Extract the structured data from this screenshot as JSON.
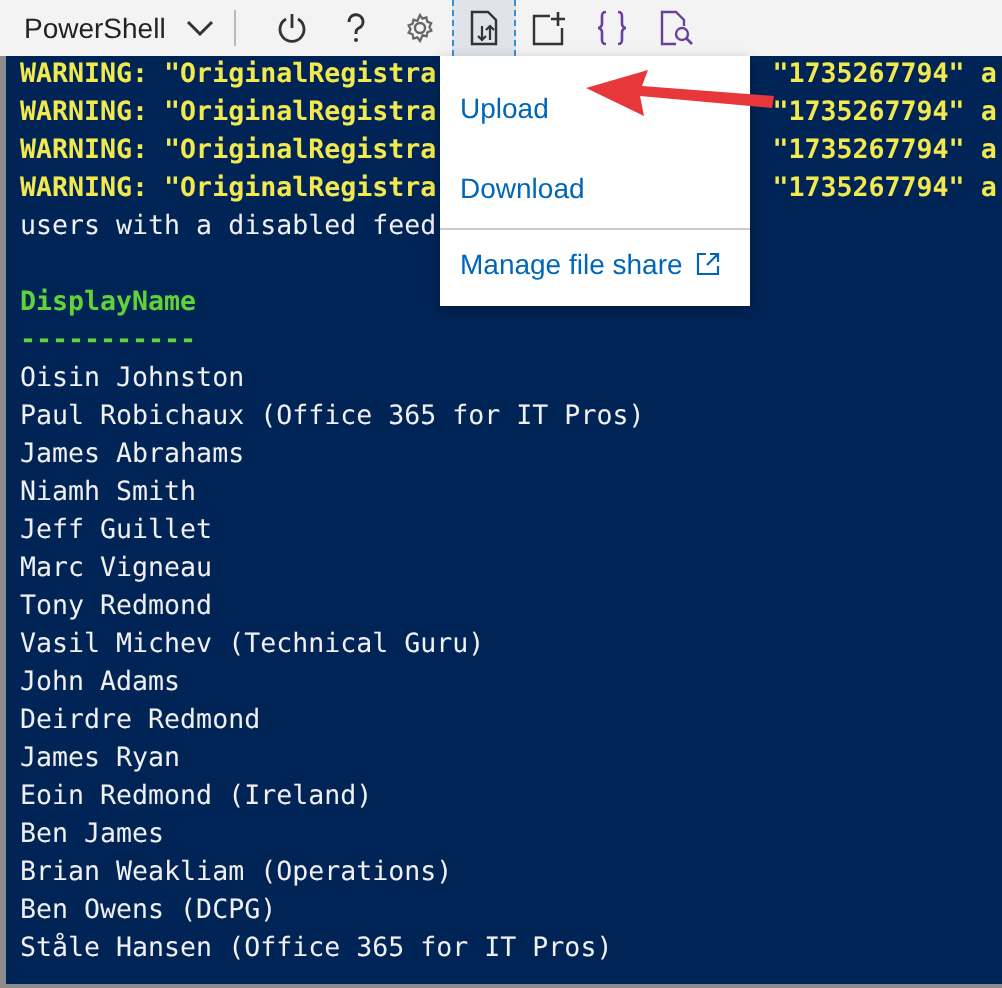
{
  "toolbar": {
    "shell_selector": "PowerShell",
    "buttons": [
      {
        "kind": "power",
        "selected": false
      },
      {
        "kind": "help",
        "selected": false
      },
      {
        "kind": "settings",
        "selected": false
      },
      {
        "kind": "upload-download",
        "selected": true
      },
      {
        "kind": "new-session",
        "selected": false
      },
      {
        "kind": "editor",
        "selected": false
      },
      {
        "kind": "web-preview",
        "selected": false
      }
    ]
  },
  "menu": {
    "items": [
      {
        "label": "Upload",
        "kind": "item"
      },
      {
        "label": "Download",
        "kind": "item"
      },
      {
        "label": "Manage file share",
        "kind": "external"
      }
    ]
  },
  "terminal": {
    "lines": [
      {
        "kind": "warning",
        "left": "WARNING: \"OriginalRegistra",
        "right": "\"1735267794\" a"
      },
      {
        "kind": "warning",
        "left": "WARNING: \"OriginalRegistra",
        "right": "\"1735267794\" a"
      },
      {
        "kind": "warning",
        "left": "WARNING: \"OriginalRegistra",
        "right": "\"1735267794\" a"
      },
      {
        "kind": "warning",
        "left": "WARNING: \"OriginalRegistra",
        "right": "\"1735267794\" a"
      },
      {
        "kind": "plain",
        "text": "users with a disabled feed"
      },
      {
        "kind": "blank"
      },
      {
        "kind": "header",
        "text": "DisplayName"
      },
      {
        "kind": "header",
        "text": "-----------"
      },
      {
        "kind": "plain",
        "text": "Oisin Johnston"
      },
      {
        "kind": "plain",
        "text": "Paul Robichaux (Office 365 for IT Pros)"
      },
      {
        "kind": "plain",
        "text": "James Abrahams"
      },
      {
        "kind": "plain",
        "text": "Niamh Smith"
      },
      {
        "kind": "plain",
        "text": "Jeff Guillet"
      },
      {
        "kind": "plain",
        "text": "Marc Vigneau"
      },
      {
        "kind": "plain",
        "text": "Tony Redmond"
      },
      {
        "kind": "plain",
        "text": "Vasil Michev (Technical Guru)"
      },
      {
        "kind": "plain",
        "text": "John Adams"
      },
      {
        "kind": "plain",
        "text": "Deirdre Redmond"
      },
      {
        "kind": "plain",
        "text": "James Ryan"
      },
      {
        "kind": "plain",
        "text": "Eoin Redmond (Ireland)"
      },
      {
        "kind": "plain",
        "text": "Ben James"
      },
      {
        "kind": "plain",
        "text": "Brian Weakliam (Operations)"
      },
      {
        "kind": "plain",
        "text": "Ben Owens (DCPG)"
      },
      {
        "kind": "plain",
        "text": "Ståle Hansen (Office 365 for IT Pros)"
      }
    ]
  }
}
